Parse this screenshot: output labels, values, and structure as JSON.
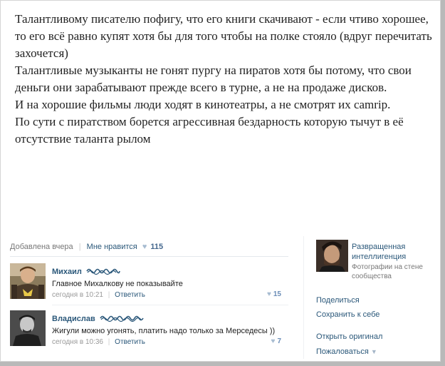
{
  "post": {
    "paragraphs": [
      "Талантливому писателю пофигу, что его книги скачивают - если чтиво хорошее, то его всё равно купят хотя бы для того чтобы на полке стояло (вдруг перечитать захочется)",
      "Талантливые музыканты не гонят пургу на пиратов хотя бы потому, что свои деньги они зарабатывают прежде всего в турне, а не на продаже дисков.",
      "И на хорошие фильмы люди ходят в кинотеатры, а не смотрят их camrip.",
      "По сути с пиратством борется агрессивная бездарность которую тычут в её отсутствие таланта рылом"
    ],
    "added": "Добавлена вчера",
    "like_label": "Мне нравится",
    "like_count": "115"
  },
  "comments": [
    {
      "name": "Михаил",
      "text": "Главное Михалкову не показывайте",
      "time": "сегодня в 10:21",
      "reply": "Ответить",
      "likes": "15"
    },
    {
      "name": "Владислав",
      "text": "Жигули можно угонять, платить надо только за Мерседесы ))",
      "time": "сегодня в 10:36",
      "reply": "Ответить",
      "likes": "7"
    }
  ],
  "sidebar": {
    "author_name": "Развращенная интеллигенция",
    "author_sub": "Фотографии на стене сообщества",
    "share": "Поделиться",
    "save": "Сохранить к себе",
    "open_original": "Открыть оригинал",
    "report": "Пожаловаться"
  },
  "icons": {
    "like": "heart-icon",
    "report_caret": "caret-down-icon"
  },
  "colors": {
    "link": "#2b587a",
    "heart": "#a7bcd1",
    "text": "#222222",
    "muted": "#777777"
  }
}
